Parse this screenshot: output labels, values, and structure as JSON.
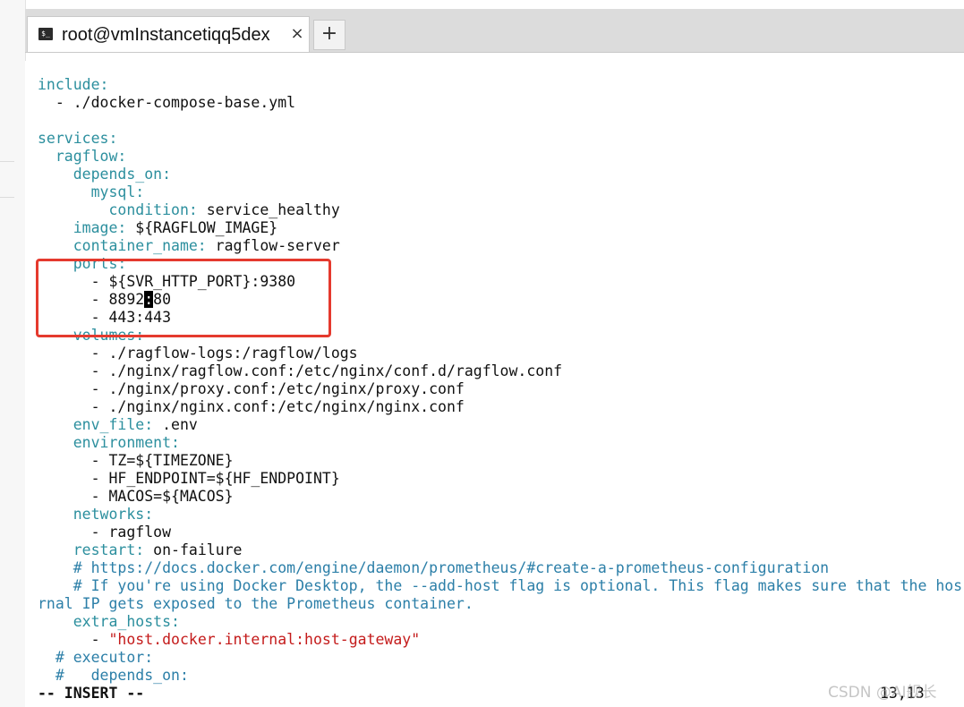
{
  "tab": {
    "icon": "terminal-icon",
    "title": "root@vmInstancetiqq5dex",
    "close_label": "×",
    "add_label": "+"
  },
  "editor": {
    "lines": [
      {
        "parts": [
          {
            "t": "include:",
            "c": "k"
          }
        ]
      },
      {
        "parts": [
          {
            "t": "  - ./docker-compose-base.yml",
            "c": "v"
          }
        ]
      },
      {
        "parts": []
      },
      {
        "parts": [
          {
            "t": "services:",
            "c": "k"
          }
        ]
      },
      {
        "parts": [
          {
            "t": "  ragflow:",
            "c": "k"
          }
        ]
      },
      {
        "parts": [
          {
            "t": "    depends_on:",
            "c": "k"
          }
        ]
      },
      {
        "parts": [
          {
            "t": "      mysql:",
            "c": "k"
          }
        ]
      },
      {
        "parts": [
          {
            "t": "        condition:",
            "c": "k"
          },
          {
            "t": " service_healthy",
            "c": "v"
          }
        ]
      },
      {
        "parts": [
          {
            "t": "    image:",
            "c": "k"
          },
          {
            "t": " ${RAGFLOW_IMAGE}",
            "c": "v"
          }
        ]
      },
      {
        "parts": [
          {
            "t": "    container_name:",
            "c": "k"
          },
          {
            "t": " ragflow-server",
            "c": "v"
          }
        ]
      },
      {
        "parts": [
          {
            "t": "    ports:",
            "c": "k"
          }
        ]
      },
      {
        "parts": [
          {
            "t": "      - ${SVR_HTTP_PORT}:9380",
            "c": "v"
          }
        ]
      },
      {
        "parts": [
          {
            "t": "      - 8892",
            "c": "v"
          },
          {
            "t": ":",
            "c": "cursor"
          },
          {
            "t": "80",
            "c": "v"
          }
        ]
      },
      {
        "parts": [
          {
            "t": "      - 443:443",
            "c": "v"
          }
        ]
      },
      {
        "parts": [
          {
            "t": "    volumes:",
            "c": "k"
          }
        ]
      },
      {
        "parts": [
          {
            "t": "      - ./ragflow-logs:/ragflow/logs",
            "c": "v"
          }
        ]
      },
      {
        "parts": [
          {
            "t": "      - ./nginx/ragflow.conf:/etc/nginx/conf.d/ragflow.conf",
            "c": "v"
          }
        ]
      },
      {
        "parts": [
          {
            "t": "      - ./nginx/proxy.conf:/etc/nginx/proxy.conf",
            "c": "v"
          }
        ]
      },
      {
        "parts": [
          {
            "t": "      - ./nginx/nginx.conf:/etc/nginx/nginx.conf",
            "c": "v"
          }
        ]
      },
      {
        "parts": [
          {
            "t": "    env_file:",
            "c": "k"
          },
          {
            "t": " .env",
            "c": "v"
          }
        ]
      },
      {
        "parts": [
          {
            "t": "    environment:",
            "c": "k"
          }
        ]
      },
      {
        "parts": [
          {
            "t": "      - TZ=${TIMEZONE}",
            "c": "v"
          }
        ]
      },
      {
        "parts": [
          {
            "t": "      - HF_ENDPOINT=${HF_ENDPOINT}",
            "c": "v"
          }
        ]
      },
      {
        "parts": [
          {
            "t": "      - MACOS=${MACOS}",
            "c": "v"
          }
        ]
      },
      {
        "parts": [
          {
            "t": "    networks:",
            "c": "k"
          }
        ]
      },
      {
        "parts": [
          {
            "t": "      - ragflow",
            "c": "v"
          }
        ]
      },
      {
        "parts": [
          {
            "t": "    restart:",
            "c": "k"
          },
          {
            "t": " on-failure",
            "c": "v"
          }
        ]
      },
      {
        "parts": [
          {
            "t": "    # https://docs.docker.com/engine/daemon/prometheus/#create-a-prometheus-configuration",
            "c": "c"
          }
        ]
      },
      {
        "parts": [
          {
            "t": "    # If you're using Docker Desktop, the --add-host flag is optional. This flag makes sure that the hos",
            "c": "c"
          }
        ]
      },
      {
        "parts": [
          {
            "t": "rnal IP gets exposed to the Prometheus container.",
            "c": "c"
          }
        ]
      },
      {
        "parts": [
          {
            "t": "    extra_hosts:",
            "c": "k"
          }
        ]
      },
      {
        "parts": [
          {
            "t": "      - ",
            "c": "v"
          },
          {
            "t": "\"host.docker.internal:host-gateway\"",
            "c": "s"
          }
        ]
      },
      {
        "parts": [
          {
            "t": "  # executor:",
            "c": "c"
          }
        ]
      },
      {
        "parts": [
          {
            "t": "  #   depends_on:",
            "c": "c"
          }
        ]
      }
    ],
    "mode": "-- INSERT --",
    "cursor_pos": "13,13"
  },
  "watermark": "CSDN @AI舰长",
  "colors": {
    "key": "#2c8f9e",
    "comment": "#2c7fa8",
    "string": "#c41b1b",
    "highlight_box": "#e53a2e"
  }
}
